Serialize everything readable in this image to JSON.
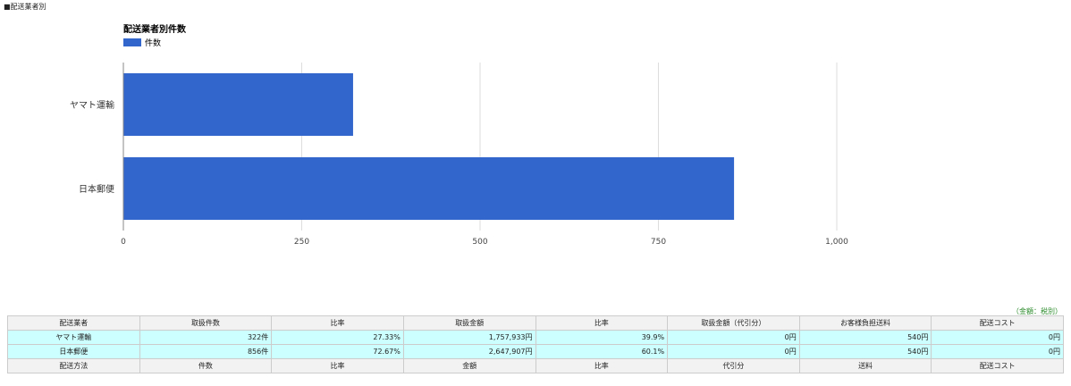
{
  "section_title": "■配送業者別",
  "note": "（金額：税別）",
  "chart_data": {
    "type": "bar",
    "orientation": "horizontal",
    "title": "配送業者別件数",
    "legend": [
      "件数"
    ],
    "categories": [
      "ヤマト運輸",
      "日本郵便"
    ],
    "values": [
      322,
      856
    ],
    "xlim": [
      0,
      1000
    ],
    "xticks": [
      0,
      250,
      500,
      750,
      1000
    ],
    "xtick_labels": [
      "0",
      "250",
      "500",
      "750",
      "1,000"
    ],
    "color": "#3366cc",
    "grid": true,
    "legend_position": "top-left"
  },
  "table": {
    "header": [
      "配送業者",
      "取扱件数",
      "比率",
      "取扱金額",
      "比率",
      "取扱金額（代引分）",
      "お客様負担送料",
      "配送コスト"
    ],
    "rows": [
      [
        "ヤマト運輸",
        "322件",
        "27.33%",
        "1,757,933円",
        "39.9%",
        "0円",
        "540円",
        "0円"
      ],
      [
        "日本郵便",
        "856件",
        "72.67%",
        "2,647,907円",
        "60.1%",
        "0円",
        "540円",
        "0円"
      ]
    ],
    "footer": [
      "配送方法",
      "件数",
      "比率",
      "金額",
      "比率",
      "代引分",
      "送料",
      "配送コスト"
    ]
  }
}
